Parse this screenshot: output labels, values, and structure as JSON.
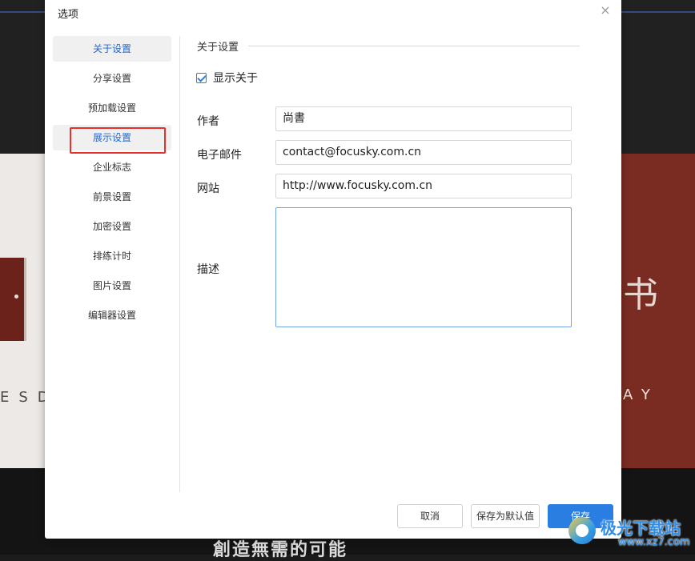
{
  "background": {
    "left_text": "ESD",
    "right_char": "书",
    "right_text": "AY",
    "caption": "創造無需的可能",
    "watermark_title": "极光下载站",
    "watermark_url": "www.xz7.com"
  },
  "dialog": {
    "title": "选项",
    "close_icon": "close-icon",
    "close_glyph": "×"
  },
  "sidebar": {
    "items": [
      {
        "label": "关于设置",
        "state": "active"
      },
      {
        "label": "分享设置",
        "state": "normal"
      },
      {
        "label": "预加载设置",
        "state": "normal"
      },
      {
        "label": "展示设置",
        "state": "hover-highlighted"
      },
      {
        "label": "企业标志",
        "state": "normal"
      },
      {
        "label": "前景设置",
        "state": "normal"
      },
      {
        "label": "加密设置",
        "state": "normal"
      },
      {
        "label": "排练计时",
        "state": "normal"
      },
      {
        "label": "图片设置",
        "state": "normal"
      },
      {
        "label": "编辑器设置",
        "state": "normal"
      }
    ]
  },
  "content": {
    "section_title": "关于设置",
    "show_about": {
      "label": "显示关于",
      "checked": true
    },
    "fields": {
      "author": {
        "label": "作者",
        "value": "尚書"
      },
      "email": {
        "label": "电子邮件",
        "value": "contact@focusky.com.cn"
      },
      "website": {
        "label": "网站",
        "value": "http://www.focusky.com.cn"
      },
      "description": {
        "label": "描述",
        "value": ""
      }
    }
  },
  "buttons": {
    "cancel": "取消",
    "save_default": "保存为默认值",
    "save": "保存"
  },
  "colors": {
    "accent": "#2a7de1",
    "active_text": "#2566c9",
    "highlight_border": "#e5302b"
  }
}
